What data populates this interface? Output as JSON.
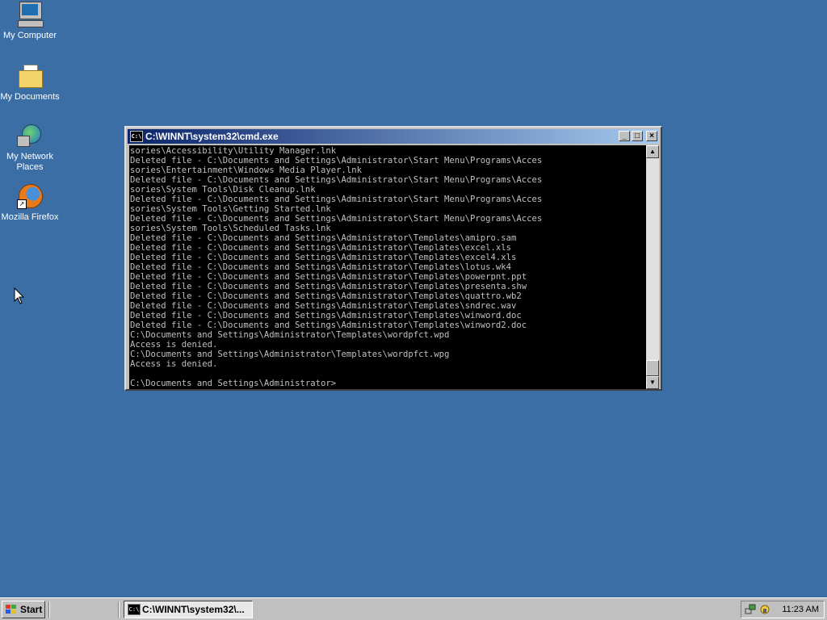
{
  "desktop": {
    "background_color": "#3a6ea5",
    "icons": [
      {
        "label": "My Computer",
        "icon": "computer-icon"
      },
      {
        "label": "My Documents",
        "icon": "folder-documents-icon"
      },
      {
        "label_line1": "My Network",
        "label_line2": "Places",
        "icon": "network-places-icon"
      },
      {
        "label": "Mozilla Firefox",
        "icon": "firefox-icon"
      }
    ]
  },
  "cmd_window": {
    "title": "C:\\WINNT\\system32\\cmd.exe",
    "icon_text": "C:\\",
    "controls": {
      "minimize": "_",
      "maximize": "□",
      "close": "×"
    },
    "lines": [
      "sories\\Accessibility\\Utility Manager.lnk",
      "Deleted file - C:\\Documents and Settings\\Administrator\\Start Menu\\Programs\\Acces",
      "sories\\Entertainment\\Windows Media Player.lnk",
      "Deleted file - C:\\Documents and Settings\\Administrator\\Start Menu\\Programs\\Acces",
      "sories\\System Tools\\Disk Cleanup.lnk",
      "Deleted file - C:\\Documents and Settings\\Administrator\\Start Menu\\Programs\\Acces",
      "sories\\System Tools\\Getting Started.lnk",
      "Deleted file - C:\\Documents and Settings\\Administrator\\Start Menu\\Programs\\Acces",
      "sories\\System Tools\\Scheduled Tasks.lnk",
      "Deleted file - C:\\Documents and Settings\\Administrator\\Templates\\amipro.sam",
      "Deleted file - C:\\Documents and Settings\\Administrator\\Templates\\excel.xls",
      "Deleted file - C:\\Documents and Settings\\Administrator\\Templates\\excel4.xls",
      "Deleted file - C:\\Documents and Settings\\Administrator\\Templates\\lotus.wk4",
      "Deleted file - C:\\Documents and Settings\\Administrator\\Templates\\powerpnt.ppt",
      "Deleted file - C:\\Documents and Settings\\Administrator\\Templates\\presenta.shw",
      "Deleted file - C:\\Documents and Settings\\Administrator\\Templates\\quattro.wb2",
      "Deleted file - C:\\Documents and Settings\\Administrator\\Templates\\sndrec.wav",
      "Deleted file - C:\\Documents and Settings\\Administrator\\Templates\\winword.doc",
      "Deleted file - C:\\Documents and Settings\\Administrator\\Templates\\winword2.doc",
      "C:\\Documents and Settings\\Administrator\\Templates\\wordpfct.wpd",
      "Access is denied.",
      "C:\\Documents and Settings\\Administrator\\Templates\\wordpfct.wpg",
      "Access is denied.",
      "",
      "C:\\Documents and Settings\\Administrator>"
    ]
  },
  "taskbar": {
    "start_label": "Start",
    "task_label": "C:\\WINNT\\system32\\...",
    "task_icon_text": "C:\\",
    "clock": "11:23 AM"
  },
  "colors": {
    "titlebar_start": "#0a246a",
    "titlebar_end": "#a6caf0",
    "console_bg": "#000000",
    "console_fg": "#c0c0c0",
    "chrome": "#c0c0c0"
  }
}
